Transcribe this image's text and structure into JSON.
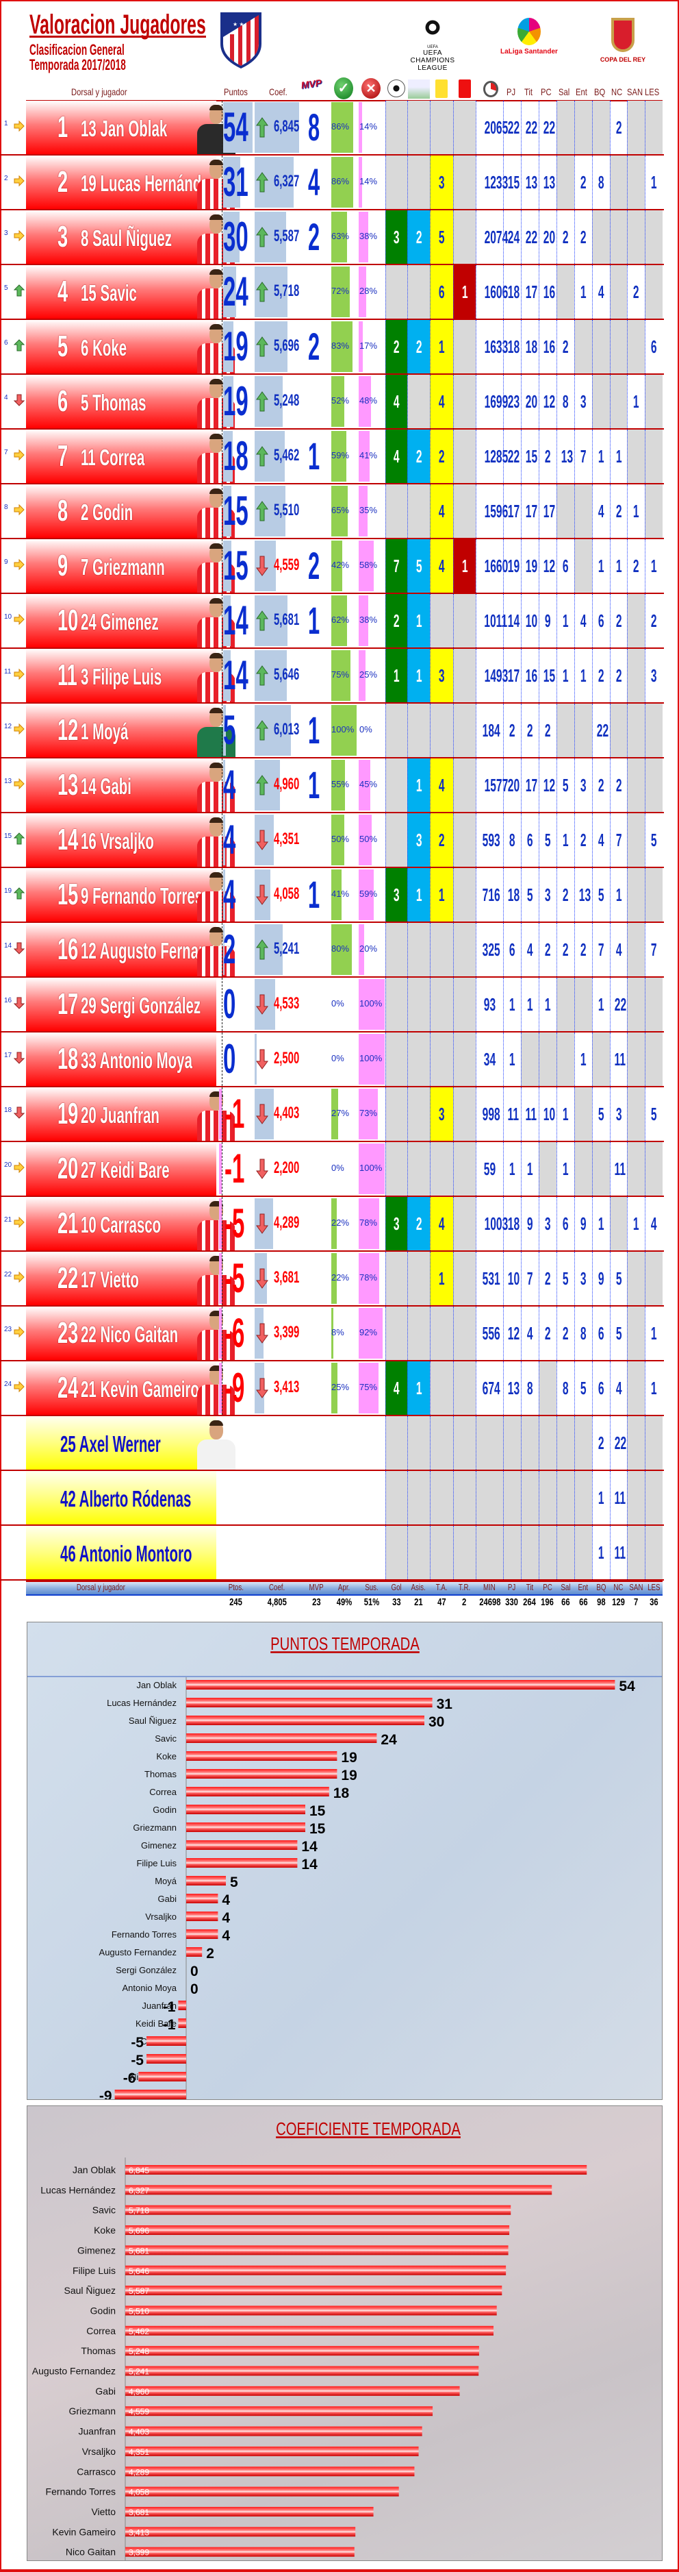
{
  "header": {
    "title": "Valoracion Jugadores",
    "subtitle1": "Clasificacion General",
    "subtitle2": "Temporada 2017/2018",
    "logos": {
      "crest": "atletico-madrid-crest",
      "champions": "UEFA CHAMPIONS LEAGUE",
      "laliga": "LaLiga Santander",
      "copa": "COPA DEL REY"
    }
  },
  "columns": {
    "dorsal": "Dorsal y jugador",
    "puntos": "Puntos",
    "coef": "Coef.",
    "icons": [
      "mvp-icon",
      "check-icon",
      "cross-icon",
      "ball-icon",
      "assist-icon",
      "yellow-card-icon",
      "red-card-icon",
      "stopwatch-icon"
    ],
    "stats": [
      "PJ",
      "Tit",
      "PC",
      "Sal",
      "Ent",
      "BQ",
      "NC",
      "SAN",
      "LES"
    ]
  },
  "colors": {
    "accent": "#c00000",
    "gol": "#008000",
    "asis": "#00b0f0",
    "ta": "#ffff00",
    "tr": "#c00000",
    "apr": "#92d050",
    "sus": "#ff99ff",
    "bar": "#b8cce4",
    "text": "#1030c0"
  },
  "players": [
    {
      "rank": "1",
      "prev": "1",
      "trend": "same",
      "dorsal": "13",
      "name": "Jan Oblak",
      "shirt": "black",
      "points": "54",
      "coef": "6,845",
      "coef_trend": "up",
      "mvp": "8",
      "apr": "86%",
      "sus": "14%",
      "gol": "",
      "asis": "",
      "ta": "",
      "tr": "",
      "min": "2065",
      "pj": "22",
      "tit": "22",
      "pc": "22",
      "sal": "",
      "ent": "",
      "bq": "",
      "nc": "2",
      "san": "",
      "les": ""
    },
    {
      "rank": "2",
      "prev": "2",
      "trend": "same",
      "dorsal": "19",
      "name": "Lucas Hernández",
      "shirt": "red",
      "points": "31",
      "coef": "6,327",
      "coef_trend": "up",
      "mvp": "4",
      "apr": "86%",
      "sus": "14%",
      "gol": "",
      "asis": "",
      "ta": "3",
      "tr": "",
      "min": "1233",
      "pj": "15",
      "tit": "13",
      "pc": "13",
      "sal": "",
      "ent": "2",
      "bq": "8",
      "nc": "",
      "san": "",
      "les": "1"
    },
    {
      "rank": "3",
      "prev": "3",
      "trend": "same",
      "dorsal": "8",
      "name": "Saul Ñiguez",
      "shirt": "red",
      "points": "30",
      "coef": "5,587",
      "coef_trend": "up",
      "mvp": "2",
      "apr": "63%",
      "sus": "38%",
      "gol": "3",
      "asis": "2",
      "ta": "5",
      "tr": "",
      "min": "2074",
      "pj": "24",
      "tit": "22",
      "pc": "20",
      "sal": "2",
      "ent": "2",
      "bq": "",
      "nc": "",
      "san": "",
      "les": ""
    },
    {
      "rank": "4",
      "prev": "5",
      "trend": "up",
      "dorsal": "15",
      "name": "Savic",
      "shirt": "red",
      "points": "24",
      "coef": "5,718",
      "coef_trend": "up",
      "mvp": "",
      "apr": "72%",
      "sus": "28%",
      "gol": "",
      "asis": "",
      "ta": "6",
      "tr": "1",
      "min": "1606",
      "pj": "18",
      "tit": "17",
      "pc": "16",
      "sal": "",
      "ent": "1",
      "bq": "4",
      "nc": "",
      "san": "2",
      "les": ""
    },
    {
      "rank": "5",
      "prev": "6",
      "trend": "up",
      "dorsal": "6",
      "name": "Koke",
      "shirt": "red",
      "points": "19",
      "coef": "5,696",
      "coef_trend": "up",
      "mvp": "2",
      "apr": "83%",
      "sus": "17%",
      "gol": "2",
      "asis": "2",
      "ta": "1",
      "tr": "",
      "min": "1633",
      "pj": "18",
      "tit": "18",
      "pc": "16",
      "sal": "2",
      "ent": "",
      "bq": "",
      "nc": "",
      "san": "",
      "les": "6"
    },
    {
      "rank": "6",
      "prev": "4",
      "trend": "down",
      "dorsal": "5",
      "name": "Thomas",
      "shirt": "red",
      "points": "19",
      "coef": "5,248",
      "coef_trend": "up",
      "mvp": "",
      "apr": "52%",
      "sus": "48%",
      "gol": "4",
      "asis": "",
      "ta": "4",
      "tr": "",
      "min": "1699",
      "pj": "23",
      "tit": "20",
      "pc": "12",
      "sal": "8",
      "ent": "3",
      "bq": "",
      "nc": "",
      "san": "1",
      "les": ""
    },
    {
      "rank": "7",
      "prev": "7",
      "trend": "same",
      "dorsal": "11",
      "name": "Correa",
      "shirt": "red",
      "points": "18",
      "coef": "5,462",
      "coef_trend": "up",
      "mvp": "1",
      "apr": "59%",
      "sus": "41%",
      "gol": "4",
      "asis": "2",
      "ta": "2",
      "tr": "",
      "min": "1285",
      "pj": "22",
      "tit": "15",
      "pc": "2",
      "sal": "13",
      "ent": "7",
      "bq": "1",
      "nc": "1",
      "san": "",
      "les": ""
    },
    {
      "rank": "8",
      "prev": "8",
      "trend": "same",
      "dorsal": "2",
      "name": "Godin",
      "shirt": "red",
      "points": "15",
      "coef": "5,510",
      "coef_trend": "up",
      "mvp": "",
      "apr": "65%",
      "sus": "35%",
      "gol": "",
      "asis": "",
      "ta": "4",
      "tr": "",
      "min": "1596",
      "pj": "17",
      "tit": "17",
      "pc": "17",
      "sal": "",
      "ent": "",
      "bq": "4",
      "nc": "2",
      "san": "1",
      "les": ""
    },
    {
      "rank": "9",
      "prev": "9",
      "trend": "same",
      "dorsal": "7",
      "name": "Griezmann",
      "shirt": "red",
      "points": "15",
      "coef": "4,559",
      "coef_trend": "down",
      "mvp": "2",
      "apr": "42%",
      "sus": "58%",
      "gol": "7",
      "asis": "5",
      "ta": "4",
      "tr": "1",
      "min": "1660",
      "pj": "19",
      "tit": "19",
      "pc": "12",
      "sal": "6",
      "ent": "",
      "bq": "1",
      "nc": "1",
      "san": "2",
      "les": "1"
    },
    {
      "rank": "10",
      "prev": "10",
      "trend": "same",
      "dorsal": "24",
      "name": "Gimenez",
      "shirt": "red",
      "points": "14",
      "coef": "5,681",
      "coef_trend": "up",
      "mvp": "1",
      "apr": "62%",
      "sus": "38%",
      "gol": "2",
      "asis": "1",
      "ta": "",
      "tr": "",
      "min": "1011",
      "pj": "14",
      "tit": "10",
      "pc": "9",
      "sal": "1",
      "ent": "4",
      "bq": "6",
      "nc": "2",
      "san": "",
      "les": "2"
    },
    {
      "rank": "11",
      "prev": "11",
      "trend": "same",
      "dorsal": "3",
      "name": "Filipe Luis",
      "shirt": "red",
      "points": "14",
      "coef": "5,646",
      "coef_trend": "up",
      "mvp": "",
      "apr": "75%",
      "sus": "25%",
      "gol": "1",
      "asis": "1",
      "ta": "3",
      "tr": "",
      "min": "1493",
      "pj": "17",
      "tit": "16",
      "pc": "15",
      "sal": "1",
      "ent": "1",
      "bq": "2",
      "nc": "2",
      "san": "",
      "les": "3"
    },
    {
      "rank": "12",
      "prev": "12",
      "trend": "same",
      "dorsal": "1",
      "name": "Moyá",
      "shirt": "green",
      "points": "5",
      "coef": "6,013",
      "coef_trend": "up",
      "mvp": "1",
      "apr": "100%",
      "sus": "0%",
      "gol": "",
      "asis": "",
      "ta": "",
      "tr": "",
      "min": "184",
      "pj": "2",
      "tit": "2",
      "pc": "2",
      "sal": "",
      "ent": "",
      "bq": "22",
      "nc": "",
      "san": "",
      "les": ""
    },
    {
      "rank": "13",
      "prev": "13",
      "trend": "same",
      "dorsal": "14",
      "name": "Gabi",
      "shirt": "red",
      "points": "4",
      "coef": "4,960",
      "coef_trend": "up",
      "mvp": "1",
      "apr": "55%",
      "sus": "45%",
      "gol": "",
      "asis": "1",
      "ta": "4",
      "tr": "",
      "min": "1577",
      "pj": "20",
      "tit": "17",
      "pc": "12",
      "sal": "5",
      "ent": "3",
      "bq": "2",
      "nc": "2",
      "san": "",
      "les": ""
    },
    {
      "rank": "14",
      "prev": "15",
      "trend": "up",
      "dorsal": "16",
      "name": "Vrsaljko",
      "shirt": "red",
      "points": "4",
      "coef": "4,351",
      "coef_trend": "down",
      "mvp": "",
      "apr": "50%",
      "sus": "50%",
      "gol": "",
      "asis": "3",
      "ta": "2",
      "tr": "",
      "min": "593",
      "pj": "8",
      "tit": "6",
      "pc": "5",
      "sal": "1",
      "ent": "2",
      "bq": "4",
      "nc": "7",
      "san": "",
      "les": "5"
    },
    {
      "rank": "15",
      "prev": "19",
      "trend": "up",
      "dorsal": "9",
      "name": "Fernando Torres",
      "shirt": "red",
      "points": "4",
      "coef": "4,058",
      "coef_trend": "down",
      "mvp": "1",
      "apr": "41%",
      "sus": "59%",
      "gol": "3",
      "asis": "1",
      "ta": "1",
      "tr": "",
      "min": "716",
      "pj": "18",
      "tit": "5",
      "pc": "3",
      "sal": "2",
      "ent": "13",
      "bq": "5",
      "nc": "1",
      "san": "",
      "les": ""
    },
    {
      "rank": "16",
      "prev": "14",
      "trend": "down",
      "dorsal": "12",
      "name": "Augusto Fernandez",
      "shirt": "red",
      "points": "2",
      "coef": "5,241",
      "coef_trend": "up",
      "mvp": "",
      "apr": "80%",
      "sus": "20%",
      "gol": "",
      "asis": "",
      "ta": "",
      "tr": "",
      "min": "325",
      "pj": "6",
      "tit": "4",
      "pc": "2",
      "sal": "2",
      "ent": "2",
      "bq": "7",
      "nc": "4",
      "san": "",
      "les": "7"
    },
    {
      "rank": "17",
      "prev": "16",
      "trend": "down",
      "dorsal": "29",
      "name": "Sergi González",
      "shirt": "none",
      "points": "0",
      "coef": "4,533",
      "coef_trend": "down",
      "mvp": "",
      "apr": "0%",
      "sus": "100%",
      "gol": "",
      "asis": "",
      "ta": "",
      "tr": "",
      "min": "93",
      "pj": "1",
      "tit": "1",
      "pc": "1",
      "sal": "",
      "ent": "",
      "bq": "1",
      "nc": "22",
      "san": "",
      "les": ""
    },
    {
      "rank": "18",
      "prev": "17",
      "trend": "down",
      "dorsal": "33",
      "name": "Antonio Moya",
      "shirt": "none",
      "points": "0",
      "coef": "2,500",
      "coef_trend": "down",
      "mvp": "",
      "apr": "0%",
      "sus": "100%",
      "gol": "",
      "asis": "",
      "ta": "",
      "tr": "",
      "min": "34",
      "pj": "1",
      "tit": "",
      "pc": "",
      "sal": "",
      "ent": "1",
      "bq": "",
      "nc": "11",
      "san": "",
      "les": ""
    },
    {
      "rank": "19",
      "prev": "18",
      "trend": "down",
      "dorsal": "20",
      "name": "Juanfran",
      "shirt": "red",
      "points": "-1",
      "coef": "4,403",
      "coef_trend": "down",
      "mvp": "",
      "apr": "27%",
      "sus": "73%",
      "gol": "",
      "asis": "",
      "ta": "3",
      "tr": "",
      "min": "998",
      "pj": "11",
      "tit": "11",
      "pc": "10",
      "sal": "1",
      "ent": "",
      "bq": "5",
      "nc": "3",
      "san": "",
      "les": "5"
    },
    {
      "rank": "20",
      "prev": "20",
      "trend": "same",
      "dorsal": "27",
      "name": "Keidi Bare",
      "shirt": "none",
      "points": "-1",
      "coef": "2,200",
      "coef_trend": "down",
      "mvp": "",
      "apr": "0%",
      "sus": "100%",
      "gol": "",
      "asis": "",
      "ta": "",
      "tr": "",
      "min": "59",
      "pj": "1",
      "tit": "1",
      "pc": "",
      "sal": "1",
      "ent": "",
      "bq": "",
      "nc": "11",
      "san": "",
      "les": ""
    },
    {
      "rank": "21",
      "prev": "21",
      "trend": "same",
      "dorsal": "10",
      "name": "Carrasco",
      "shirt": "red",
      "points": "-5",
      "coef": "4,289",
      "coef_trend": "down",
      "mvp": "",
      "apr": "22%",
      "sus": "78%",
      "gol": "3",
      "asis": "2",
      "ta": "4",
      "tr": "",
      "min": "1003",
      "pj": "18",
      "tit": "9",
      "pc": "3",
      "sal": "6",
      "ent": "9",
      "bq": "1",
      "nc": "",
      "san": "1",
      "les": "4"
    },
    {
      "rank": "22",
      "prev": "22",
      "trend": "same",
      "dorsal": "17",
      "name": "Vietto",
      "shirt": "red",
      "points": "-5",
      "coef": "3,681",
      "coef_trend": "down",
      "mvp": "",
      "apr": "22%",
      "sus": "78%",
      "gol": "",
      "asis": "",
      "ta": "1",
      "tr": "",
      "min": "531",
      "pj": "10",
      "tit": "7",
      "pc": "2",
      "sal": "5",
      "ent": "3",
      "bq": "9",
      "nc": "5",
      "san": "",
      "les": ""
    },
    {
      "rank": "23",
      "prev": "23",
      "trend": "same",
      "dorsal": "22",
      "name": "Nico Gaitan",
      "shirt": "red",
      "points": "-6",
      "coef": "3,399",
      "coef_trend": "down",
      "mvp": "",
      "apr": "8%",
      "sus": "92%",
      "gol": "",
      "asis": "",
      "ta": "",
      "tr": "",
      "min": "556",
      "pj": "12",
      "tit": "4",
      "pc": "2",
      "sal": "2",
      "ent": "8",
      "bq": "6",
      "nc": "5",
      "san": "",
      "les": "1"
    },
    {
      "rank": "24",
      "prev": "24",
      "trend": "same",
      "dorsal": "21",
      "name": "Kevin Gameiro",
      "shirt": "red",
      "points": "-9",
      "coef": "3,413",
      "coef_trend": "down",
      "mvp": "",
      "apr": "25%",
      "sus": "75%",
      "gol": "4",
      "asis": "1",
      "ta": "",
      "tr": "",
      "min": "674",
      "pj": "13",
      "tit": "8",
      "pc": "",
      "sal": "8",
      "ent": "5",
      "bq": "6",
      "nc": "4",
      "san": "",
      "les": "1"
    }
  ],
  "extra_players": [
    {
      "dorsal": "25",
      "name": "Axel Werner",
      "shirt": "white",
      "bq": "2",
      "nc": "22"
    },
    {
      "dorsal": "42",
      "name": "Alberto Ródenas",
      "shirt": "none",
      "bq": "1",
      "nc": "11"
    },
    {
      "dorsal": "46",
      "name": "Antonio Montoro",
      "shirt": "none",
      "bq": "1",
      "nc": "11"
    }
  ],
  "footer": {
    "labels": [
      "Dorsal y jugador",
      "Ptos.",
      "Coef.",
      "MVP",
      "Apr.",
      "Sus.",
      "Gol",
      "Asis.",
      "T.A.",
      "T.R.",
      "MIN",
      "PJ",
      "Tit",
      "PC",
      "Sal",
      "Ent",
      "BQ",
      "NC",
      "SAN",
      "LES"
    ],
    "totals": [
      "",
      "245",
      "4,805",
      "23",
      "49%",
      "51%",
      "33",
      "21",
      "47",
      "2",
      "24698",
      "330",
      "264",
      "196",
      "66",
      "66",
      "98",
      "129",
      "7",
      "36"
    ]
  },
  "chart_data": [
    {
      "type": "bar",
      "orientation": "horizontal",
      "title": "PUNTOS TEMPORADA",
      "categories": [
        "Jan Oblak",
        "Lucas Hernández",
        "Saul Ñiguez",
        "Savic",
        "Koke",
        "Thomas",
        "Correa",
        "Godin",
        "Griezmann",
        "Gimenez",
        "Filipe Luis",
        "Moyá",
        "Gabi",
        "Vrsaljko",
        "Fernando Torres",
        "Augusto Fernandez",
        "Sergi González",
        "Antonio Moya",
        "Juanfran",
        "Keidi Bare",
        "Carrasco",
        "Vietto",
        "Nico Gaitan",
        "Kevin Gameiro"
      ],
      "values": [
        54,
        31,
        30,
        24,
        19,
        19,
        18,
        15,
        15,
        14,
        14,
        5,
        4,
        4,
        4,
        2,
        0,
        0,
        -1,
        -1,
        -5,
        -5,
        -6,
        -9
      ],
      "data_labels": true,
      "xlim": [
        -9,
        54
      ],
      "grid": false
    },
    {
      "type": "bar",
      "orientation": "horizontal",
      "title": "COEFICIENTE TEMPORADA",
      "categories": [
        "Jan Oblak",
        "Lucas Hernández",
        "Savic",
        "Koke",
        "Gimenez",
        "Filipe Luis",
        "Saul Ñiguez",
        "Godin",
        "Correa",
        "Thomas",
        "Augusto Fernandez",
        "Gabi",
        "Griezmann",
        "Juanfran",
        "Vrsaljko",
        "Carrasco",
        "Fernando Torres",
        "Vietto",
        "Kevin Gameiro",
        "Nico Gaitan"
      ],
      "values": [
        6.845,
        6.327,
        5.718,
        5.696,
        5.681,
        5.646,
        5.587,
        5.51,
        5.462,
        5.248,
        5.241,
        4.96,
        4.559,
        4.403,
        4.351,
        4.289,
        4.058,
        3.681,
        3.413,
        3.399
      ],
      "value_labels": [
        "6,845",
        "6,327",
        "5,718",
        "5,696",
        "5,681",
        "5,646",
        "5,587",
        "5,510",
        "5,462",
        "5,248",
        "5,241",
        "4,960",
        "4,559",
        "4,403",
        "4,351",
        "4,289",
        "4,058",
        "3,681",
        "3,413",
        "3,399"
      ],
      "data_labels": true,
      "xlim": [
        0,
        6.845
      ],
      "grid": false
    }
  ]
}
